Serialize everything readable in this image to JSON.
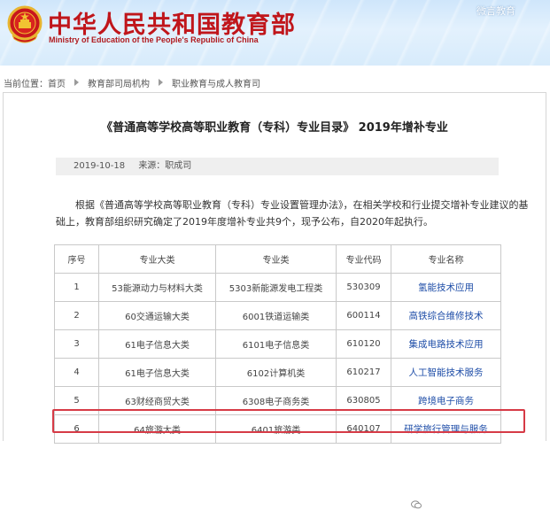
{
  "header": {
    "title": "中华人民共和国教育部",
    "subtitle": "Ministry of Education of the People's Republic of China",
    "wechat": "微言教育"
  },
  "breadcrumb": {
    "label": "当前位置：",
    "items": [
      "首页",
      "教育部司局机构",
      "职业教育与成人教育司"
    ]
  },
  "article": {
    "title": "《普通高等学校高等职业教育（专科）专业目录》 2019年增补专业",
    "date": "2019-10-18",
    "source": "来源：职成司",
    "para1": "根据《普通高等学校高等职业教育（专科）专业设置管理办法》，在相关学校和行业提交增补专业建议的基",
    "para2": "础上，教育部组织研究确定了2019年度增补专业共9个，现予公布，自2020年起执行。"
  },
  "table": {
    "headers": [
      "序号",
      "专业大类",
      "专业类",
      "专业代码",
      "专业名称"
    ],
    "rows": [
      [
        "1",
        "53能源动力与材料大类",
        "5303新能源发电工程类",
        "530309",
        "氢能技术应用"
      ],
      [
        "2",
        "60交通运输大类",
        "6001铁道运输类",
        "600114",
        "高铁综合维修技术"
      ],
      [
        "3",
        "61电子信息大类",
        "6101电子信息类",
        "610120",
        "集成电路技术应用"
      ],
      [
        "4",
        "61电子信息大类",
        "6102计算机类",
        "610217",
        "人工智能技术服务"
      ],
      [
        "5",
        "63财经商贸大类",
        "6308电子商务类",
        "630805",
        "跨境电子商务"
      ],
      [
        "6",
        "64旅游大类",
        "6401旅游类",
        "640107",
        "研学旅行管理与服务"
      ]
    ]
  },
  "colors": {
    "title_red": "#c0161b",
    "link_blue": "#1f4ea8",
    "highlight_red": "#d63a46"
  }
}
